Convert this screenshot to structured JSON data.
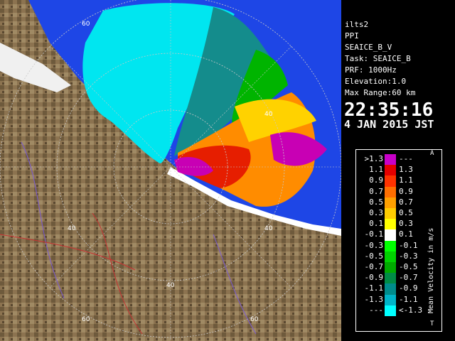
{
  "info": {
    "station": "ilts2",
    "mode": "PPI",
    "product": "SEAICE_B_V",
    "task": "Task: SEAICE_B",
    "prf": "PRF: 1000Hz",
    "elevation": "Elevation:1.0",
    "range": "Max Range:60 km",
    "time": "22:35:16",
    "date": "4 JAN 2015 JST"
  },
  "legend": {
    "title": "Mean Velocity in m/s",
    "corner_top": "A",
    "corner_bottom": "T",
    "rows": [
      {
        "left": ">1.3",
        "right": "---",
        "color": "#c800c8"
      },
      {
        "left": "1.1",
        "right": "1.3",
        "color": "#e60000"
      },
      {
        "left": "0.9",
        "right": "1.1",
        "color": "#ff3200"
      },
      {
        "left": "0.7",
        "right": "0.9",
        "color": "#ff6e00"
      },
      {
        "left": "0.5",
        "right": "0.7",
        "color": "#ffa000"
      },
      {
        "left": "0.3",
        "right": "0.5",
        "color": "#ffcc00"
      },
      {
        "left": "0.1",
        "right": "0.3",
        "color": "#ffff00"
      },
      {
        "left": "-0.1",
        "right": "0.1",
        "color": "#ffffff"
      },
      {
        "left": "-0.3",
        "right": "-0.1",
        "color": "#00ff00"
      },
      {
        "left": "-0.5",
        "right": "-0.3",
        "color": "#00d200"
      },
      {
        "left": "-0.7",
        "right": "-0.5",
        "color": "#00aa00"
      },
      {
        "left": "-0.9",
        "right": "-0.7",
        "color": "#008c46"
      },
      {
        "left": "-1.1",
        "right": "-0.9",
        "color": "#008c8c"
      },
      {
        "left": "-1.3",
        "right": "-1.1",
        "color": "#00b4c8"
      },
      {
        "left": "---",
        "right": "<-1.3",
        "color": "#00ffff"
      }
    ]
  },
  "rings": [
    "60",
    "40",
    "40",
    "40",
    "40",
    "60",
    "60"
  ],
  "colors": {
    "sea": "#1e46e6",
    "land": "#8c7350",
    "echo_cyan": "#00e6f0",
    "echo_magenta": "#c800b4",
    "grid": "#c8c8c8"
  }
}
